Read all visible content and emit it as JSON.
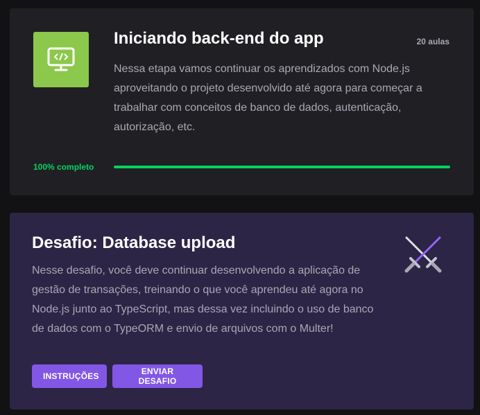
{
  "module": {
    "icon": "monitor-code-icon",
    "icon_color": "#8cc84b",
    "title": "Iniciando back-end do app",
    "lesson_count": "20 aulas",
    "description": "Nessa etapa vamos continuar os aprendizados com Node.js aproveitando o projeto desenvolvido até agora para começar a trabalhar com conceitos de banco de dados, autenticação, autorização, etc.",
    "progress_label": "100% completo",
    "progress_fraction": 1.0,
    "progress_color": "#04d361"
  },
  "challenge": {
    "title": "Desafio: Database upload",
    "description": "Nesse desafio, você deve continuar desenvolvendo a aplicação de gestão de transações, treinando o que você aprendeu até agora no Node.js junto ao TypeScript, mas dessa vez incluindo o uso de banco de dados com o TypeORM e envio de arquivos com o Multer!",
    "icon": "crossed-swords-icon",
    "buttons": {
      "instructions": "Instruções",
      "submit": "Enviar desafio"
    },
    "accent_color": "#8257e5"
  }
}
